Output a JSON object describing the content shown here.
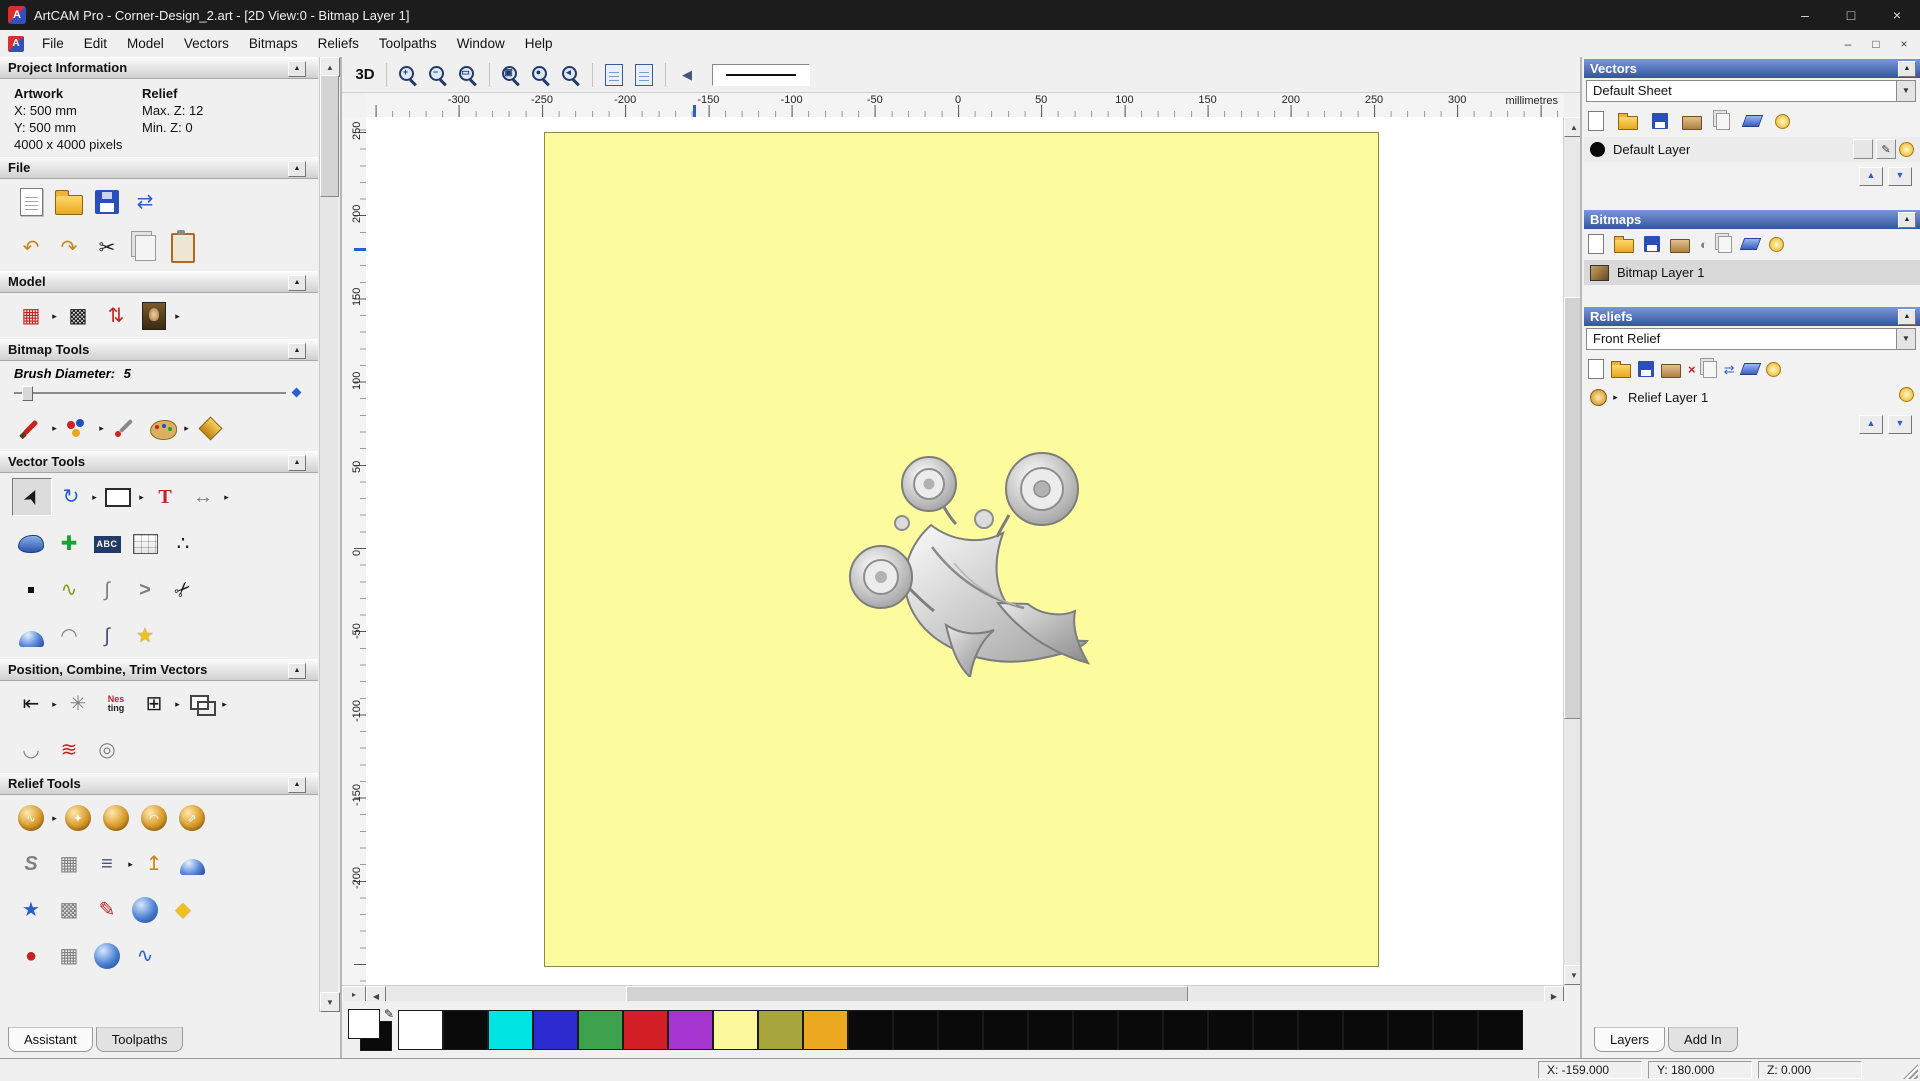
{
  "titlebar": {
    "title": "ArtCAM Pro - Corner-Design_2.art - [2D View:0 - Bitmap Layer 1]"
  },
  "menubar": {
    "items": [
      "File",
      "Edit",
      "Model",
      "Vectors",
      "Bitmaps",
      "Reliefs",
      "Toolpaths",
      "Window",
      "Help"
    ]
  },
  "left_panel": {
    "project_information": {
      "title": "Project Information",
      "artwork_label": "Artwork",
      "relief_label": "Relief",
      "artwork_x": "X: 500 mm",
      "artwork_y": "Y: 500 mm",
      "artwork_pixels": "4000 x 4000 pixels",
      "relief_max_z": "Max. Z: 12",
      "relief_min_z": "Min. Z: 0"
    },
    "file_section": {
      "title": "File"
    },
    "model_section": {
      "title": "Model"
    },
    "bitmap_tools": {
      "title": "Bitmap Tools",
      "brush_label": "Brush Diameter:",
      "brush_value": "5"
    },
    "vector_tools": {
      "title": "Vector Tools"
    },
    "position_combine": {
      "title": "Position, Combine, Trim Vectors"
    },
    "relief_tools": {
      "title": "Relief Tools"
    },
    "nesting_line1": "Nes",
    "nesting_line2": "ting",
    "tabs": {
      "assistant": "Assistant",
      "toolpaths": "Toolpaths"
    }
  },
  "toolbar": {
    "view_3d": "3D"
  },
  "rulers": {
    "horizontal": [
      "-300",
      "-250",
      "-200",
      "-150",
      "-100",
      "-50",
      "0",
      "50",
      "100",
      "150",
      "200",
      "250",
      "300"
    ],
    "vertical": [
      "250",
      "200",
      "150",
      "100",
      "50",
      "0",
      "-50",
      "-100",
      "-150",
      "-200"
    ],
    "unit": "millimetres"
  },
  "canvas": {
    "background": "#fcfc9e",
    "width_mm": 500,
    "height_mm": 500
  },
  "right_panel": {
    "vectors": {
      "title": "Vectors",
      "sheet": "Default Sheet",
      "layer_name": "Default Layer"
    },
    "bitmaps": {
      "title": "Bitmaps",
      "layer_name": "Bitmap Layer 1"
    },
    "reliefs": {
      "title": "Reliefs",
      "relief": "Front Relief",
      "layer_name": "Relief Layer 1"
    },
    "tabs": {
      "layers": "Layers",
      "addin": "Add In"
    }
  },
  "palette": {
    "colors": [
      "#ffffff",
      "#0a0a0a",
      "#00e4e4",
      "#2b2bd0",
      "#3ca24e",
      "#d41f27",
      "#a436cf",
      "#fbf99b",
      "#a6a63c",
      "#eca81f",
      "#0a0a0a",
      "#0a0a0a",
      "#0a0a0a",
      "#0a0a0a",
      "#0a0a0a",
      "#0a0a0a",
      "#0a0a0a",
      "#0a0a0a",
      "#0a0a0a",
      "#0a0a0a",
      "#0a0a0a",
      "#0a0a0a",
      "#0a0a0a",
      "#0a0a0a",
      "#0a0a0a"
    ]
  },
  "statusbar": {
    "x": "X: -159.000",
    "y": "Y: 180.000",
    "z": "Z: 0.000"
  },
  "icons": {
    "app_logo": "A",
    "minimize": "–",
    "maximize": "□",
    "close": "×",
    "child_min": "–",
    "child_restore": "□",
    "child_close": "×",
    "flyout": "▸",
    "collapse": "▲",
    "dropdown": "▼",
    "up": "▲",
    "down": "▼",
    "left": "◀",
    "right": "▶",
    "undo": "↶",
    "redo": "↷",
    "cut": "✂",
    "transfer": "⇄",
    "grid_red": "▦",
    "greyscale": "▩",
    "invert": "⇅",
    "select": "➤",
    "rotate": "↻",
    "text_t": "T",
    "measure": "↔",
    "plus_green": "✚",
    "abc": "ABC",
    "dots": "∴",
    "wave": "∿",
    "bezier": "∫",
    "chevron": ">",
    "star": "★",
    "arc": "◠",
    "join": "◡",
    "weld": "≋",
    "spiral": "◎",
    "align": "⇤",
    "array": "✳",
    "blocks": "⊞",
    "smooth": "∿",
    "sculpt": "✦",
    "sweep": "◠",
    "extrude": "⇗",
    "s_profile": "S",
    "weave": "▦",
    "stack": "≡",
    "pin": "↥",
    "plane": "◆",
    "dot_red": "●",
    "sun": "☀",
    "pencil": "✎",
    "contrast": "◐",
    "clear_red": "×",
    "plus": "+",
    "zoom_in": "+",
    "zoom_out": "−",
    "zoom_window": "▭",
    "zoom_fit": "▣",
    "zoom_obj": "●",
    "zoom_prev": "◂"
  }
}
